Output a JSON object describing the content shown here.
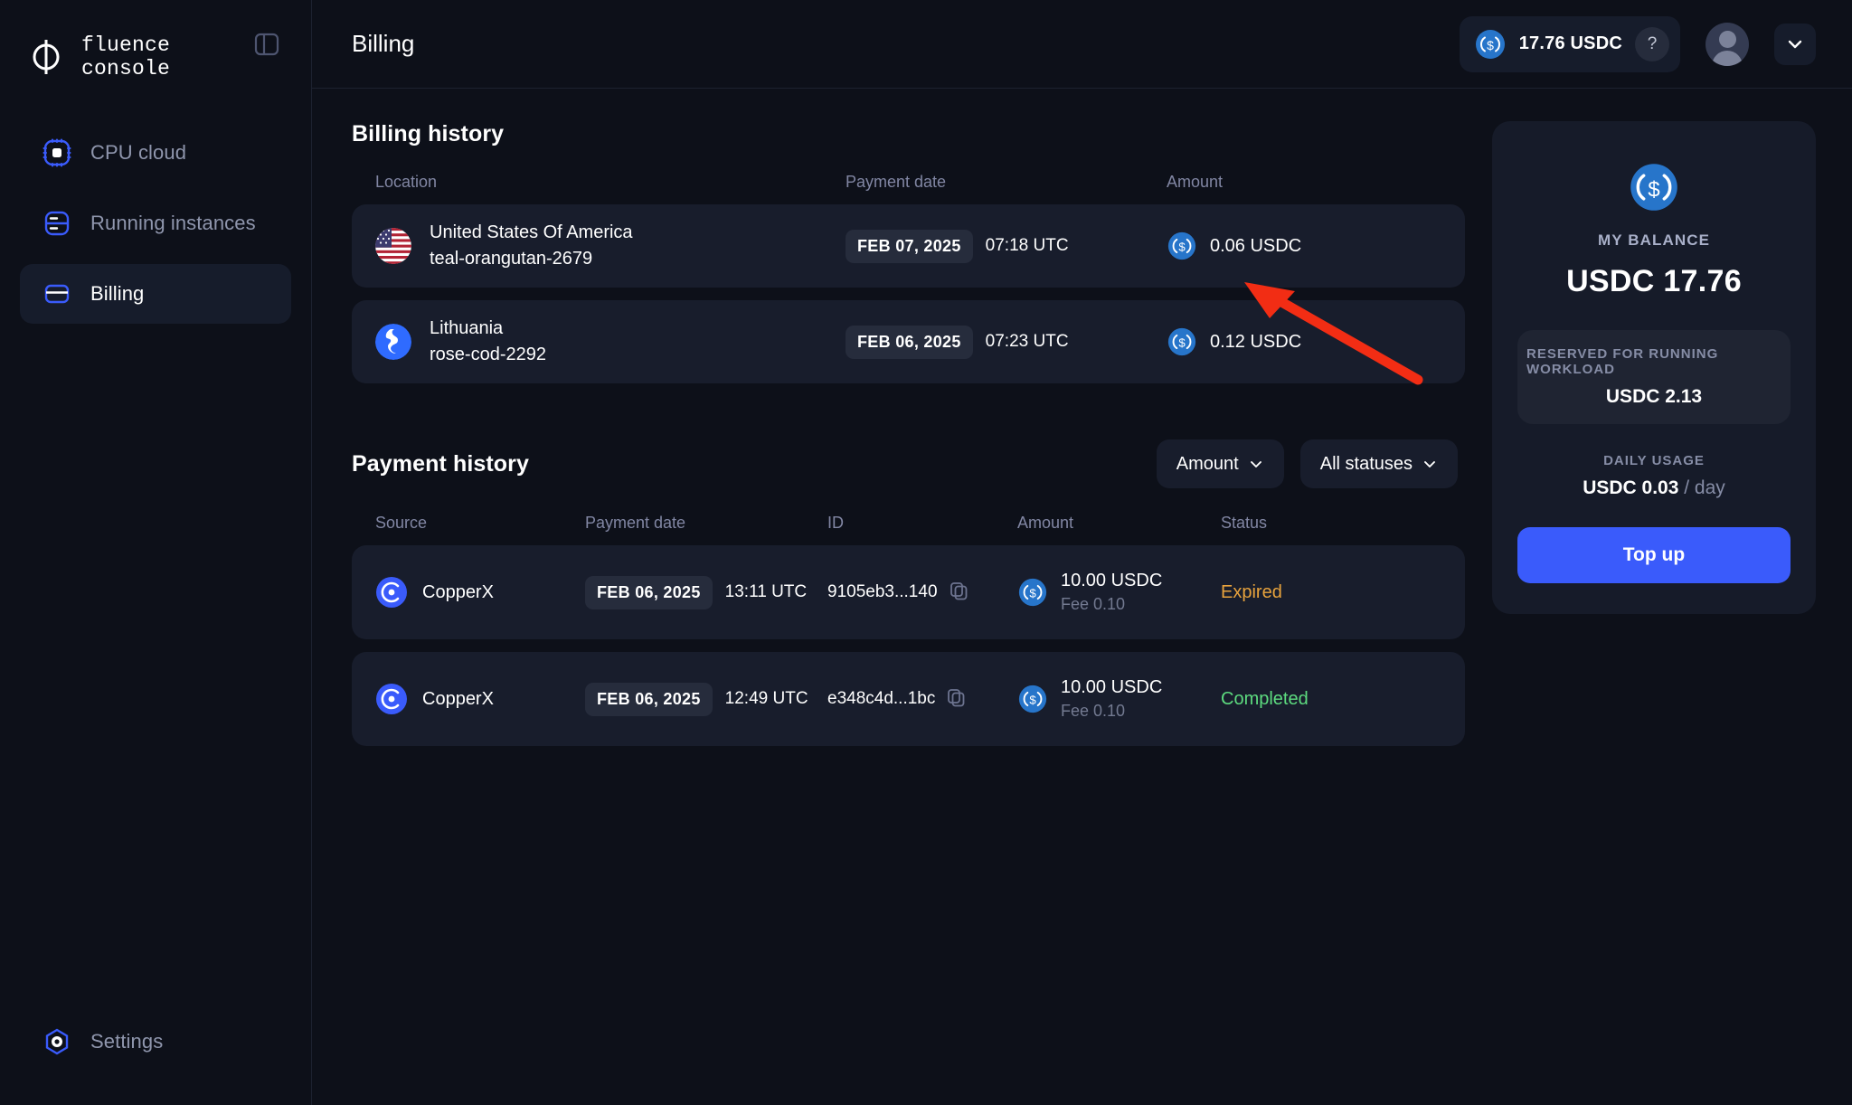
{
  "brand": {
    "name_line1": "fluence",
    "name_line2": "console",
    "logo_icon": "phi-logo-icon"
  },
  "sidebar": {
    "panel_toggle_icon": "panel-collapse-icon",
    "items": [
      {
        "label": "CPU cloud",
        "icon": "cpu-chip-icon",
        "active": false
      },
      {
        "label": "Running instances",
        "icon": "server-stack-icon",
        "active": false
      },
      {
        "label": "Billing",
        "icon": "credit-card-icon",
        "active": true
      }
    ],
    "settings": {
      "label": "Settings",
      "icon": "settings-hexagon-icon"
    }
  },
  "header": {
    "title": "Billing",
    "balance_pill": {
      "amount": "17.76 USDC",
      "coin_icon": "usdc-coin-icon",
      "help_label": "?"
    },
    "avatar_icon": "user-avatar-icon",
    "chevron_icon": "chevron-down-icon"
  },
  "billing_history": {
    "title": "Billing history",
    "columns": [
      "Location",
      "Payment date",
      "Amount"
    ],
    "rows": [
      {
        "flag": "us-flag-icon",
        "country": "United States Of America",
        "instance": "teal-orangutan-2679",
        "date": "FEB 07, 2025",
        "time": "07:18 UTC",
        "amount": "0.06 USDC",
        "coin_icon": "usdc-coin-icon"
      },
      {
        "flag": "lt-flag-icon",
        "country": "Lithuania",
        "instance": "rose-cod-2292",
        "date": "FEB 06, 2025",
        "time": "07:23 UTC",
        "amount": "0.12 USDC",
        "coin_icon": "usdc-coin-icon"
      }
    ]
  },
  "payment_history": {
    "title": "Payment history",
    "filters": [
      {
        "label": "Amount",
        "icon": "chevron-down-icon"
      },
      {
        "label": "All statuses",
        "icon": "chevron-down-icon"
      }
    ],
    "columns": [
      "Source",
      "Payment date",
      "ID",
      "Amount",
      "Status"
    ],
    "rows": [
      {
        "source": "CopperX",
        "source_icon": "copperx-icon",
        "date": "FEB 06, 2025",
        "time": "13:11 UTC",
        "id": "9105eb3...140",
        "copy_icon": "copy-icon",
        "amount": "10.00 USDC",
        "fee": "Fee 0.10",
        "coin_icon": "usdc-coin-icon",
        "status": "Expired",
        "status_color": "#e8a33d"
      },
      {
        "source": "CopperX",
        "source_icon": "copperx-icon",
        "date": "FEB 06, 2025",
        "time": "12:49 UTC",
        "id": "e348c4d...1bc",
        "copy_icon": "copy-icon",
        "amount": "10.00 USDC",
        "fee": "Fee 0.10",
        "coin_icon": "usdc-coin-icon",
        "status": "Completed",
        "status_color": "#5ddb7f"
      }
    ]
  },
  "balance_card": {
    "coin_icon": "usdc-coin-icon",
    "label": "MY BALANCE",
    "amount": "USDC 17.76",
    "reserved_label": "RESERVED FOR RUNNING WORKLOAD",
    "reserved_value": "USDC 2.13",
    "daily_label": "DAILY USAGE",
    "daily_value": "USDC 0.03",
    "daily_unit": "/ day",
    "topup_label": "Top up"
  },
  "annotation": {
    "arrow_color": "#f22d14",
    "icon": "pointer-arrow"
  },
  "colors": {
    "background": "#0d1019",
    "card": "#181d2c",
    "accent": "#3a5bfb",
    "status_expired": "#e8a33d",
    "status_completed": "#5ddb7f"
  }
}
